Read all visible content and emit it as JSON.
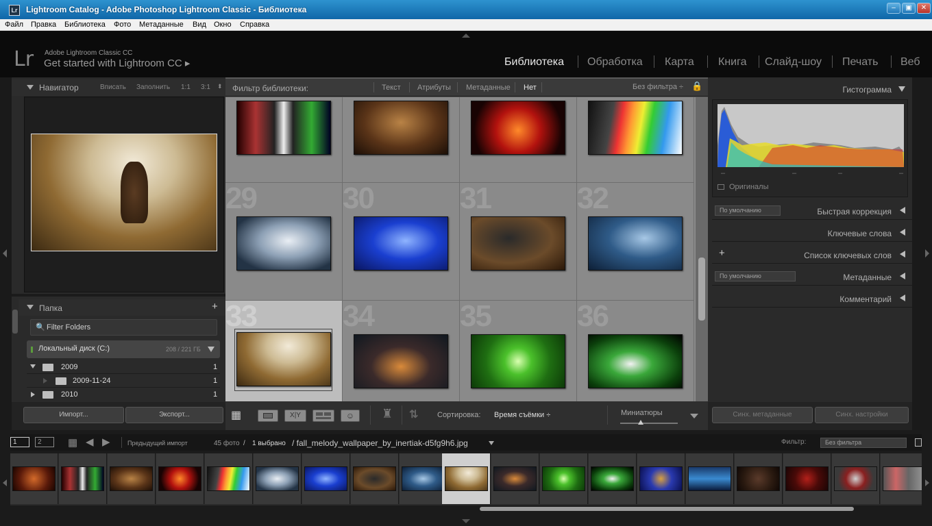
{
  "window": {
    "title": "Lightroom Catalog - Adobe Photoshop Lightroom Classic - Библиотека",
    "icon_text": "Lr",
    "min": "–",
    "restore": "▣",
    "close": "✕"
  },
  "menu": [
    "Файл",
    "Правка",
    "Библиотека",
    "Фото",
    "Метаданные",
    "Вид",
    "Окно",
    "Справка"
  ],
  "identity": {
    "logo": "Lr",
    "product": "Adobe Lightroom Classic CC",
    "prompt": "Get started with Lightroom CC ▸"
  },
  "modules": [
    "Библиотека",
    "Обработка",
    "Карта",
    "Книга",
    "Слайд-шоу",
    "Печать",
    "Веб"
  ],
  "navigator": {
    "title": "Навигатор",
    "zoom": [
      "Вписать",
      "Заполнить",
      "1:1",
      "3:1"
    ]
  },
  "folders": {
    "title": "Папка",
    "add": "+",
    "filter_placeholder": "Filter Folders",
    "disk": {
      "name": "Локальный диск (C:)",
      "usage": "208 / 221 ГБ"
    },
    "items": [
      {
        "name": "2009",
        "count": "1"
      },
      {
        "name": "2009-11-24",
        "count": "1"
      },
      {
        "name": "2010",
        "count": "1"
      }
    ]
  },
  "left_buttons": {
    "import": "Импорт...",
    "export": "Экспорт..."
  },
  "filterbar": {
    "label": "Фильтр библиотеки:",
    "options": [
      "Текст",
      "Атрибуты",
      "Метаданные",
      "Нет"
    ],
    "preset": "Без фильтра ÷"
  },
  "grid": {
    "row_numbers": [
      "29",
      "30",
      "31",
      "32",
      "33",
      "34",
      "35",
      "36"
    ]
  },
  "toolbar": {
    "sort_label": "Сортировка:",
    "sort_value": "Время съёмки ÷",
    "thumbs_label": "Миниатюры"
  },
  "right": {
    "histogram": "Гистограмма",
    "originals": "Оригиналы",
    "hist_ticks": [
      "–",
      "–",
      "–",
      "–"
    ],
    "sections": [
      {
        "title": "Быстрая коррекция",
        "preset": "По умолчанию"
      },
      {
        "title": "Ключевые слова"
      },
      {
        "title": "Список ключевых слов",
        "add": "+"
      },
      {
        "title": "Метаданные",
        "preset": "По умолчанию"
      },
      {
        "title": "Комментарий"
      }
    ],
    "sync_meta": "Синх. метаданные",
    "sync_settings": "Синх. настройки"
  },
  "filmstrip": {
    "page1": "1",
    "page2": "2",
    "source": "Предыдущий импорт",
    "count": "45 фото",
    "selected": "1 выбрано",
    "file": "/ fall_melody_wallpaper_by_inertiak-d5fg9h6.jpg",
    "filter_label": "Фильтр:",
    "filter_value": "Без фильтра"
  },
  "colors": {
    "accent": "#1f77b8",
    "panel": "#2a2a2a",
    "grid": "#8a8a8a"
  }
}
